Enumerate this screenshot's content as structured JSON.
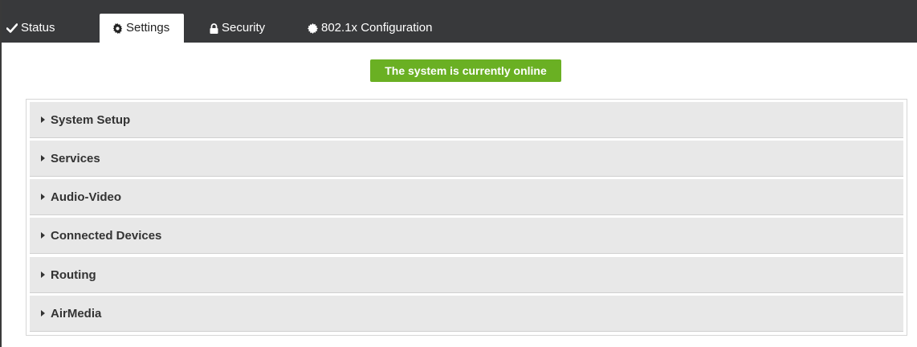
{
  "tabs": [
    {
      "label": "Status",
      "icon": "check-icon"
    },
    {
      "label": "Settings",
      "icon": "gear-icon"
    },
    {
      "label": "Security",
      "icon": "lock-icon"
    },
    {
      "label": "802.1x Configuration",
      "icon": "badge-icon"
    }
  ],
  "active_tab": "Settings",
  "status_banner": {
    "text": "The system is currently online",
    "color": "#6ab023"
  },
  "sections": [
    {
      "label": "System Setup"
    },
    {
      "label": "Services"
    },
    {
      "label": "Audio-Video"
    },
    {
      "label": "Connected Devices"
    },
    {
      "label": "Routing"
    },
    {
      "label": "AirMedia"
    }
  ],
  "colors": {
    "tabbar": "#38393b",
    "accordion_bg": "#e8e8e8"
  }
}
